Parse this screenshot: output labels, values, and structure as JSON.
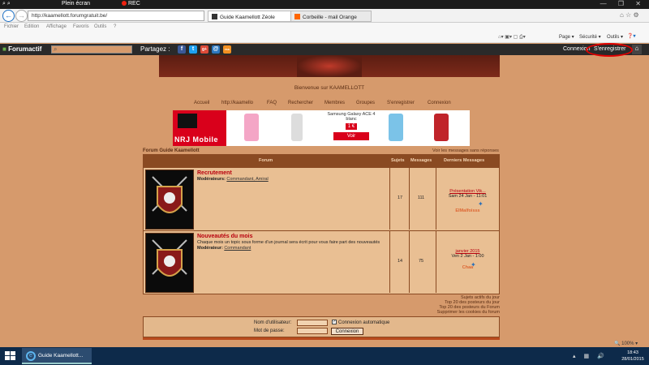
{
  "recbar": {
    "fullscreen_label": "Plein écran",
    "rec_label": "REC"
  },
  "browser": {
    "address": "http://kaamellott.forumgratuit.be/",
    "tabs": [
      {
        "label": "Guide Kaamellott Zéole"
      },
      {
        "label": "Corbeille - mail Orange"
      }
    ],
    "menu": [
      "Fichier",
      "Edition",
      "Affichage",
      "Favoris",
      "Outils",
      "?"
    ],
    "commands": {
      "page": "Page ▾",
      "securite": "Sécurité ▾",
      "outils": "Outils ▾"
    }
  },
  "forumactif_bar": {
    "brand": "Forumactif",
    "share_label": "Partagez :",
    "connexion": "Connexion",
    "register": "S'enregistrer",
    "share_icons": [
      "f",
      "t",
      "g+",
      "@",
      "rss"
    ]
  },
  "welcome": "Bienvenue sur KAAMELLOTT",
  "nav": [
    "Accueil",
    "http://kaamello",
    "FAQ",
    "Rechercher",
    "Membres",
    "Groupes",
    "S'enregistrer",
    "Connexion"
  ],
  "ad": {
    "brand": "NRJ Mobile",
    "product": "Samsung Galaxy ACE 4 blanc",
    "price": "1 €",
    "cta": "Voir"
  },
  "forum": {
    "label": "Forum Guide Kaamellott",
    "unanswered": "Voir les messages sans réponses",
    "headers": {
      "forum": "Forum",
      "topics": "Sujets",
      "messages": "Messages",
      "last": "Derniers Messages"
    },
    "rows": [
      {
        "title": "Recrutement",
        "description": "",
        "moderators_label": "Modérateurs:",
        "moderators": "Commandant, Amiral",
        "topics": "17",
        "messages": "111",
        "last_title": "Présentation Vik...",
        "last_date": "Sam 24 Jan - 11:01",
        "last_user": "ElMalfoisss"
      },
      {
        "title": "Nouveautés du mois",
        "description": "Chaque mois un topic sous forme d'un journal sera écrit pour vous faire part des nouveautés",
        "moderators_label": "Modérateur:",
        "moderators": "Commandant",
        "topics": "14",
        "messages": "75",
        "last_title": "janvier 2015",
        "last_date": "Ven 2 Jan - 1:00",
        "last_user": "Chaa"
      }
    ]
  },
  "links": [
    "Sujets actifs du jour",
    "Top 20 des posteurs du jour",
    "Top 20 des posteurs du Forum",
    "Supprimer les cookies du forum"
  ],
  "login": {
    "username_label": "Nom d'utilisateur:",
    "password_label": "Mot de passe:",
    "auto_label": "Connexion automatique",
    "submit": "Connexion"
  },
  "zoom": "🔍 100% ▾",
  "taskbar": {
    "app_label": "Guide Kaamellott...",
    "time": "18:43",
    "date": "28/01/2015"
  },
  "colors": {
    "accent": "#b8000e",
    "brand_bar": "#2a2a2a",
    "forum_bg": "#d69a6c",
    "highlight": "#e20000"
  }
}
